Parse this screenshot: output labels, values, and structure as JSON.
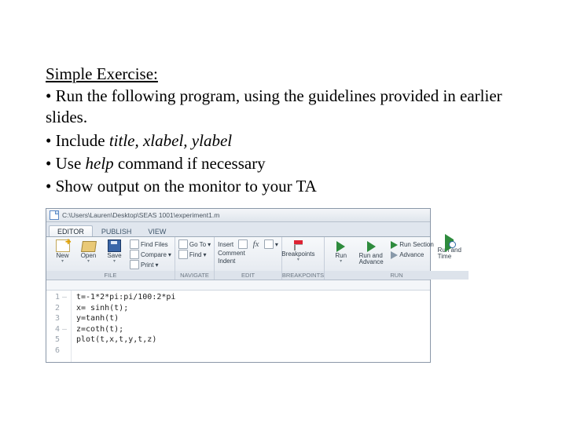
{
  "heading": "Simple Exercise:",
  "bullets": {
    "b1_pre": "• Run the following program, using the guidelines provided in earlier slides.",
    "b2_pre": "• Include ",
    "b2_em": "title, xlabel, ylabel",
    "b3_pre": "• Use ",
    "b3_em": "help",
    "b3_post": " command if necessary",
    "b4": "• Show output on the monitor to your TA"
  },
  "matlab": {
    "path": "C:\\Users\\Lauren\\Desktop\\SEAS 1001\\experiment1.m",
    "tabs": {
      "editor": "EDITOR",
      "publish": "PUBLISH",
      "view": "VIEW"
    },
    "file": {
      "new": "New",
      "open": "Open",
      "save": "Save",
      "findfiles": "Find Files",
      "compare": "Compare",
      "print": "Print",
      "label": "FILE"
    },
    "navigate": {
      "goto": "Go To",
      "find": "Find",
      "label": "NAVIGATE"
    },
    "edit": {
      "insert": "Insert",
      "comment": "Comment",
      "indent": "Indent",
      "fx": "fx",
      "label": "EDIT"
    },
    "breakpoints": {
      "name": "Breakpoints",
      "label": "BREAKPOINTS"
    },
    "run": {
      "run": "Run",
      "runadv": "Run and\nAdvance",
      "runsec": "Run Section",
      "advance": "Advance",
      "runtime": "Run and\nTime",
      "label": "RUN"
    },
    "code": {
      "l1": "t=-1*2*pi:pi/100:2*pi",
      "l2": "x= sinh(t);",
      "l3": "y=tanh(t)",
      "l4": "z=coth(t);",
      "l5": "plot(t,x,t,y,t,z)",
      "n1": "1",
      "n2": "2",
      "n3": "3",
      "n4": "4",
      "n5": "5",
      "n6": "6",
      "dash": "–"
    }
  }
}
